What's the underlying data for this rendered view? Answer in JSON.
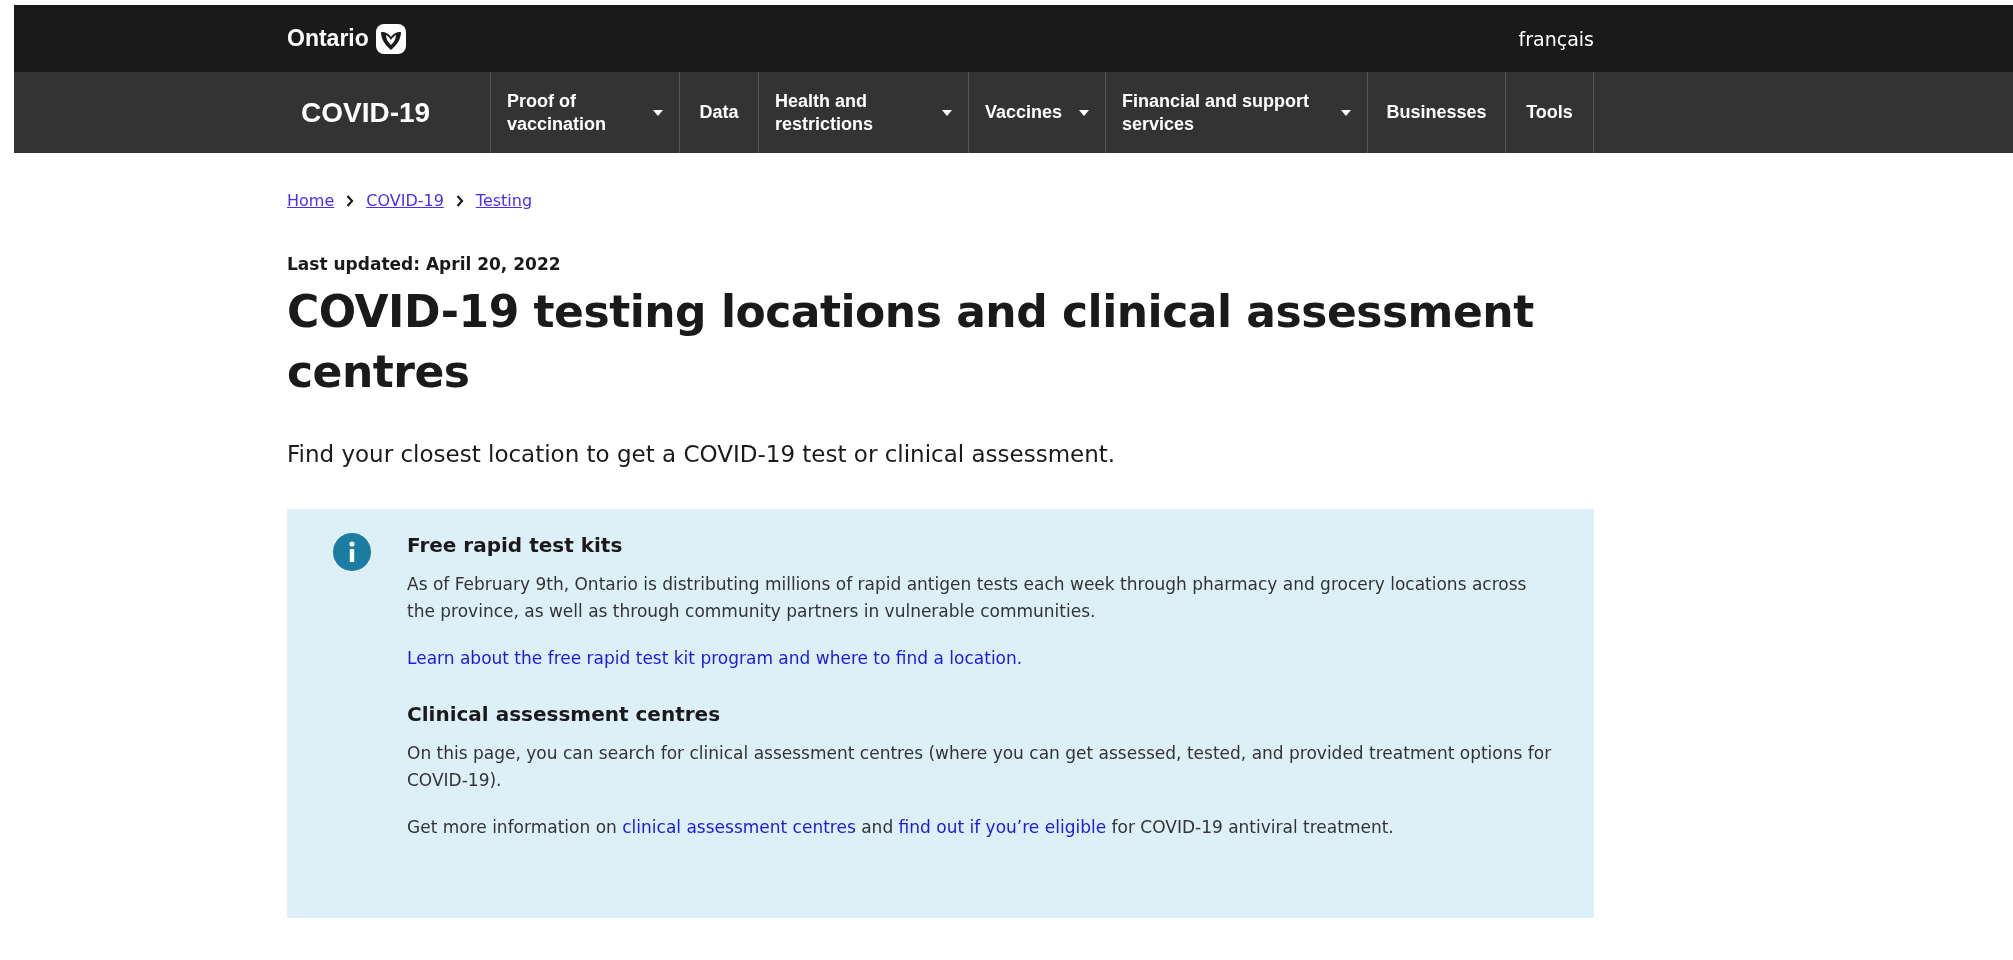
{
  "header": {
    "logo": "Ontario",
    "language_link": "français"
  },
  "nav": {
    "title": "COVID-19",
    "items": [
      {
        "label": "Proof of vaccination",
        "has_menu": true
      },
      {
        "label": "Data",
        "has_menu": false
      },
      {
        "label": "Health and restrictions",
        "has_menu": true
      },
      {
        "label": "Vaccines",
        "has_menu": true
      },
      {
        "label": "Financial and support services",
        "has_menu": true
      },
      {
        "label": "Businesses",
        "has_menu": false
      },
      {
        "label": "Tools",
        "has_menu": false
      }
    ]
  },
  "breadcrumb": [
    "Home",
    "COVID-19",
    "Testing"
  ],
  "last_updated": "Last updated: April 20, 2022",
  "title": "COVID-19 testing locations and clinical assessment centres",
  "lead": "Find your closest location to get a COVID-19 test or clinical assessment.",
  "callout": {
    "sections": [
      {
        "heading": "Free rapid test kits",
        "paragraphs": [
          [
            {
              "kind": "text",
              "text": "As of February 9th, Ontario is distributing millions of rapid antigen tests each week through pharmacy and grocery locations across the province, as well as through community partners in vulnerable communities."
            }
          ],
          [
            {
              "kind": "link",
              "text": "Learn about the free rapid test kit program and where to find a location."
            }
          ]
        ]
      },
      {
        "heading": "Clinical assessment centres",
        "paragraphs": [
          [
            {
              "kind": "text",
              "text": "On this page, you can search for clinical assessment centres (where you can get assessed, tested, and provided treatment options for COVID-19)."
            }
          ],
          [
            {
              "kind": "text",
              "text": "Get more information on "
            },
            {
              "kind": "link",
              "text": "clinical assessment centres"
            },
            {
              "kind": "text",
              "text": " and "
            },
            {
              "kind": "link",
              "text": "find out if you’re eligible"
            },
            {
              "kind": "text",
              "text": " for COVID-19 antiviral treatment."
            }
          ]
        ]
      }
    ]
  }
}
